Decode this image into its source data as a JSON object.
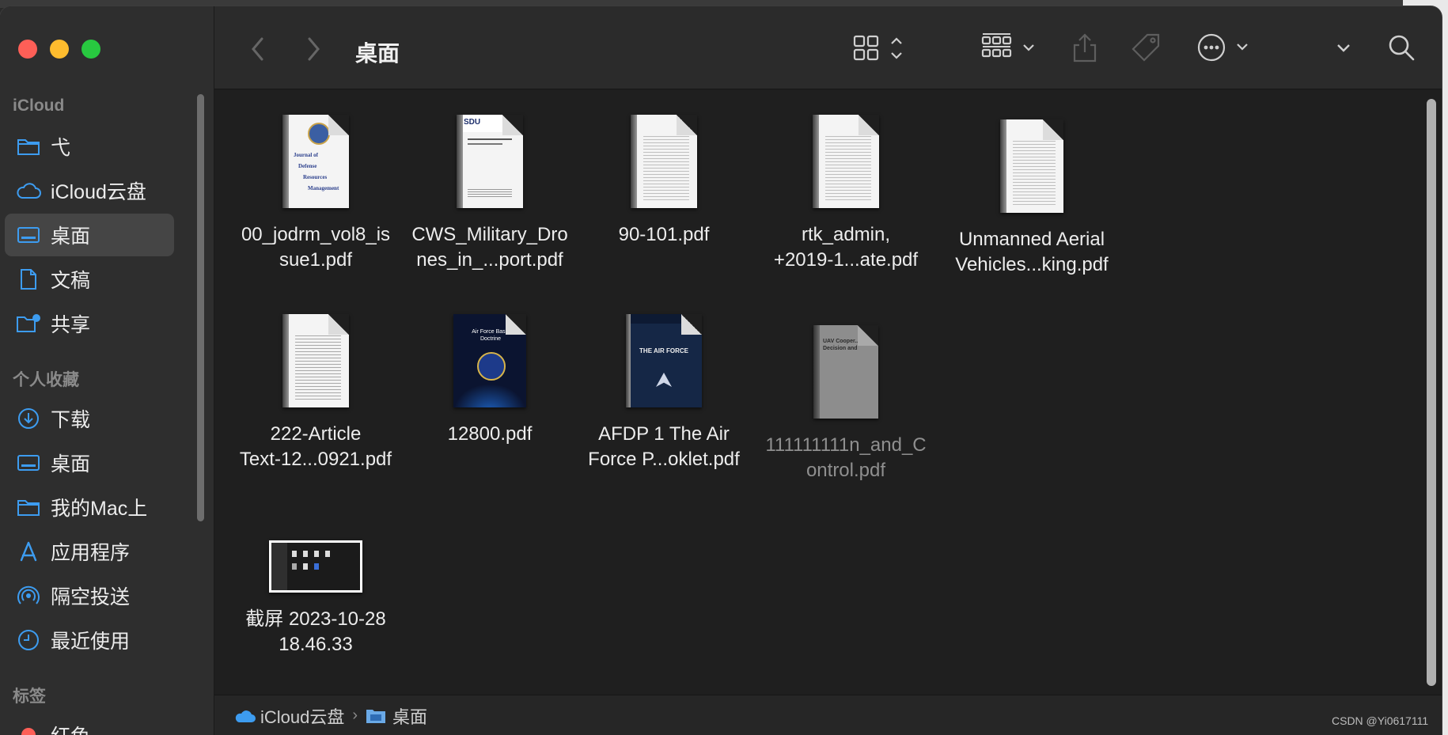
{
  "window": {
    "title": "桌面"
  },
  "sidebar": {
    "sections": [
      {
        "heading": "iCloud",
        "items": [
          {
            "label": "弋",
            "icon": "folder-icon"
          },
          {
            "label": "iCloud云盘",
            "icon": "cloud-icon"
          },
          {
            "label": "桌面",
            "icon": "desktop-icon",
            "selected": true
          },
          {
            "label": "文稿",
            "icon": "document-icon"
          },
          {
            "label": "共享",
            "icon": "shared-folder-icon"
          }
        ]
      },
      {
        "heading": "个人收藏",
        "items": [
          {
            "label": "下载",
            "icon": "download-icon"
          },
          {
            "label": "桌面",
            "icon": "desktop-icon"
          },
          {
            "label": "我的Mac上",
            "icon": "folder-icon"
          },
          {
            "label": "应用程序",
            "icon": "applications-icon"
          },
          {
            "label": "隔空投送",
            "icon": "airdrop-icon"
          },
          {
            "label": "最近使用",
            "icon": "clock-icon"
          }
        ]
      },
      {
        "heading": "标签",
        "items": [
          {
            "label": "红色",
            "icon": "red-tag-icon"
          }
        ]
      }
    ]
  },
  "toolbar": {
    "back_icon": "chevron-left-icon",
    "forward_icon": "chevron-right-icon",
    "view_icon": "icon-grid-view-icon",
    "group_icon": "group-by-icon",
    "share_icon": "share-icon",
    "tag_icon": "tag-icon",
    "action_icon": "more-actions-icon",
    "search_icon": "search-icon"
  },
  "files": [
    {
      "name": "00_jodrm_vol8_issue1.pdf",
      "line1": "00_jodrm_vol8_is",
      "line2": "sue1.pdf"
    },
    {
      "name": "CWS_Military_Drones_in_...port.pdf",
      "line1": "CWS_Military_Dro",
      "line2": "nes_in_...port.pdf"
    },
    {
      "name": "90-101.pdf",
      "line1": "90-101.pdf",
      "line2": ""
    },
    {
      "name": "rtk_admin, +2019-1...ate.pdf",
      "line1": "rtk_admin,",
      "line2": "+2019-1...ate.pdf"
    },
    {
      "name": "Unmanned Aerial Vehicles...king.pdf",
      "line1": "Unmanned Aerial",
      "line2": "Vehicles...king.pdf"
    },
    {
      "name": "222-Article Text-12...0921.pdf",
      "line1": "222-Article",
      "line2": "Text-12...0921.pdf"
    },
    {
      "name": "12800.pdf",
      "line1": "12800.pdf",
      "line2": ""
    },
    {
      "name": "AFDP 1 The Air Force P...oklet.pdf",
      "line1": "AFDP 1 The Air",
      "line2": "Force P...oklet.pdf"
    },
    {
      "name": "111111111n_and_Control.pdf",
      "line1": "111111111n_and_C",
      "line2": "ontrol.pdf",
      "dimmed": true
    },
    {
      "name": "截屏 2023-10-28 18.46.33",
      "line1": "截屏 2023-10-28",
      "line2": "18.46.33"
    }
  ],
  "thumb_text": {
    "jodrm": [
      "Journal of",
      "Defense",
      "Resources",
      "Management"
    ],
    "cws_logo": "SDU",
    "airforce_title": "Air Force Basic Doctrine",
    "afdp_title": "THE AIR FORCE",
    "uav_title": "UAV Cooper... Decision and"
  },
  "pathbar": {
    "items": [
      {
        "label": "iCloud云盘",
        "icon": "cloud-icon"
      },
      {
        "label": "桌面",
        "icon": "desktop-folder-icon"
      }
    ],
    "separator": "›"
  },
  "watermark": "CSDN @Yi0617111"
}
